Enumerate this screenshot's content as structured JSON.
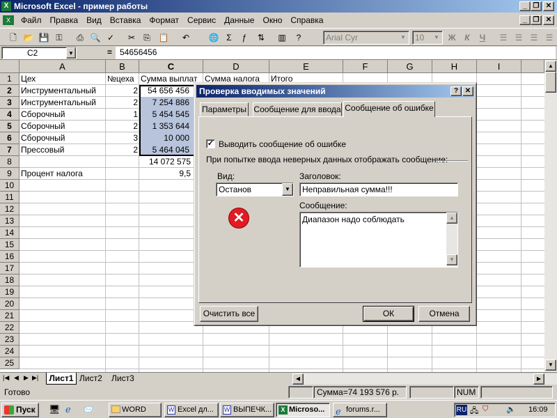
{
  "window": {
    "title": "Microsoft Excel - пример работы"
  },
  "menu": [
    "Файл",
    "Правка",
    "Вид",
    "Вставка",
    "Формат",
    "Сервис",
    "Данные",
    "Окно",
    "Справка"
  ],
  "toolbar": {
    "font": "Arial Cyr",
    "size": "10",
    "bold": "Ж",
    "italic": "К",
    "underline": "Ч"
  },
  "formula": {
    "cell": "C2",
    "fx": "=",
    "value": "54656456"
  },
  "columns": [
    "A",
    "B",
    "C",
    "D",
    "E",
    "F",
    "G",
    "H",
    "I"
  ],
  "rows": [
    "1",
    "2",
    "3",
    "4",
    "5",
    "6",
    "7",
    "8",
    "9",
    "10",
    "11",
    "12",
    "13",
    "14",
    "15",
    "16",
    "17",
    "18",
    "19",
    "20",
    "21",
    "22",
    "23",
    "24",
    "25"
  ],
  "cells": {
    "a1": "Цех",
    "b1": "№цеха",
    "c1": "Сумма выплат",
    "d1": "Сумма налога",
    "e1": "Итого",
    "a2": "Инструментальный",
    "b2": "2",
    "c2": "54 656 456",
    "a3": "Инструментальный",
    "b3": "2",
    "c3": "7 254 886",
    "a4": "Сборочный",
    "b4": "1",
    "c4": "5 454 545",
    "a5": "Сборочный",
    "b5": "2",
    "c5": "1 353 644",
    "a6": "Сборочный",
    "b6": "3",
    "c6": "10 000",
    "a7": "Прессовый",
    "b7": "2",
    "c7": "5 464 045",
    "c8": "14 072 575",
    "a9": "Процент налога",
    "c9": "9,5"
  },
  "sheets": [
    "Лист1",
    "Лист2",
    "Лист3"
  ],
  "status": {
    "ready": "Готово",
    "sum": "Сумма=74 193 576 р.",
    "num": "NUM"
  },
  "taskbar": {
    "start": "Пуск",
    "tasks": [
      "WORD",
      "Excel дл...",
      "ВЫПЕЧК...",
      "Microso...",
      "forums.r..."
    ],
    "lang": "RU",
    "clock": "16:09"
  },
  "dialog": {
    "title": "Проверка вводимых значений",
    "tabs": [
      "Параметры",
      "Сообщение для ввода",
      "Сообщение об ошибке"
    ],
    "show_error_label": "Выводить сообщение об ошибке",
    "prompt": "При попытке ввода неверных данных отображать сообщение:",
    "style_label": "Вид:",
    "style_value": "Останов",
    "title_label": "Заголовок:",
    "title_value": "Неправильная сумма!!!",
    "message_label": "Сообщение:",
    "message_value": "Диапазон надо соблюдать",
    "clear_all": "Очистить все",
    "ok": "ОК",
    "cancel": "Отмена"
  }
}
